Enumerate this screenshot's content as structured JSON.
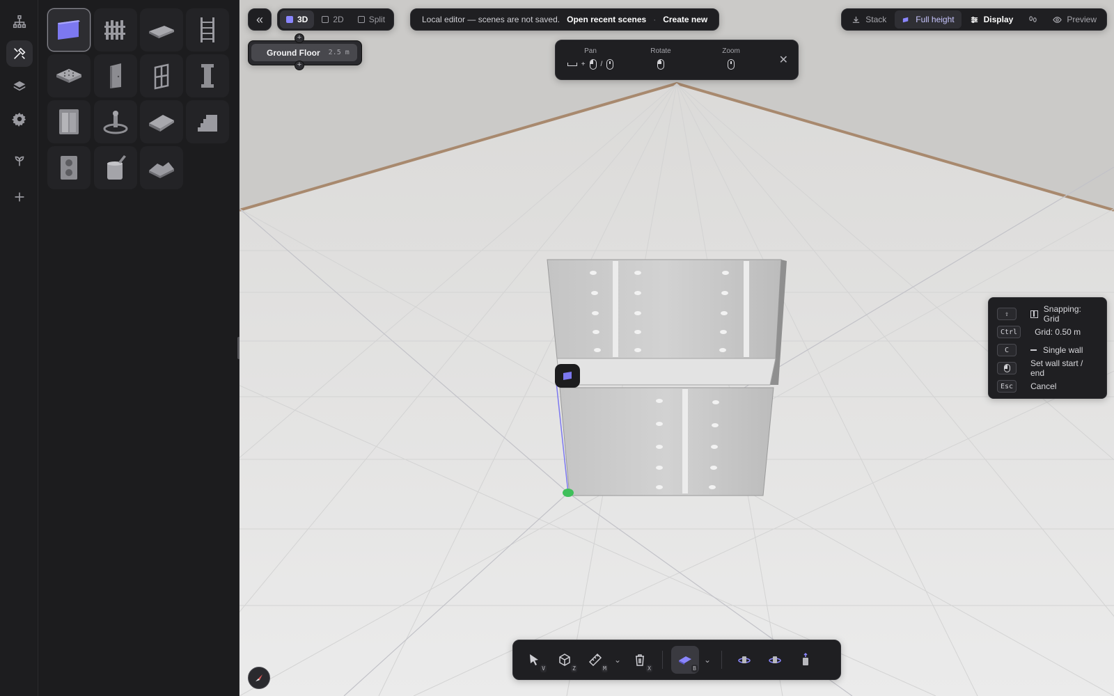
{
  "rail": {
    "items": [
      {
        "icon": "hierarchy-icon",
        "active": false
      },
      {
        "icon": "tools-icon",
        "active": true
      },
      {
        "icon": "layers-icon",
        "active": false
      },
      {
        "icon": "gear-icon",
        "active": false
      },
      {
        "icon": "sprout-icon",
        "active": false
      },
      {
        "icon": "plus-icon",
        "active": false
      }
    ]
  },
  "palette": {
    "tools": [
      {
        "icon": "wall-tool-icon",
        "active": true
      },
      {
        "icon": "fence-tool-icon",
        "active": false
      },
      {
        "icon": "slab-tool-icon",
        "active": false
      },
      {
        "icon": "ladder-tool-icon",
        "active": false
      },
      {
        "icon": "ceiling-tool-icon",
        "active": false
      },
      {
        "icon": "door-tool-icon",
        "active": false
      },
      {
        "icon": "window-tool-icon",
        "active": false
      },
      {
        "icon": "column-tool-icon",
        "active": false
      },
      {
        "icon": "elevator-tool-icon",
        "active": false
      },
      {
        "icon": "fountain-tool-icon",
        "active": false
      },
      {
        "icon": "roof-tool-icon",
        "active": false
      },
      {
        "icon": "stairs-tool-icon",
        "active": false
      },
      {
        "icon": "hvac-tool-icon",
        "active": false
      },
      {
        "icon": "paint-tool-icon",
        "active": false
      },
      {
        "icon": "terrain-tool-icon",
        "active": false
      }
    ]
  },
  "toolbar": {
    "view_modes": [
      {
        "label": "3D",
        "active": true
      },
      {
        "label": "2D",
        "active": false
      },
      {
        "label": "Split",
        "active": false
      }
    ],
    "notice_text": "Local editor — scenes are not saved.",
    "open_recent_label": "Open recent scenes",
    "separator": "·",
    "create_new_label": "Create new",
    "right": {
      "stack_label": "Stack",
      "full_height_label": "Full height",
      "display_label": "Display",
      "preview_label": "Preview"
    }
  },
  "floor": {
    "name": "Ground Floor",
    "height": "2.5 m"
  },
  "controls_hint": {
    "pan_label": "Pan",
    "pan_separator": "/",
    "rotate_label": "Rotate",
    "zoom_label": "Zoom"
  },
  "shortcuts": [
    {
      "key": "⇧",
      "label": "Snapping: Grid"
    },
    {
      "key": "Ctrl",
      "label": "Grid: 0.50 m"
    },
    {
      "key": "C",
      "label": "Single wall"
    },
    {
      "key": "mouse",
      "label": "Set wall start / end"
    },
    {
      "key": "Esc",
      "label": "Cancel"
    }
  ],
  "bottom_toolbar": {
    "select_key": "V",
    "box_key": "Z",
    "measure_key": "M",
    "delete_key": "X",
    "build_key": "B"
  },
  "colors": {
    "accent": "#8a86ff",
    "panel": "#1f1f22",
    "viewport_floor": "#e6e6e6",
    "boundary_line": "#a8896e",
    "anchor_point": "#3fbf5a"
  }
}
